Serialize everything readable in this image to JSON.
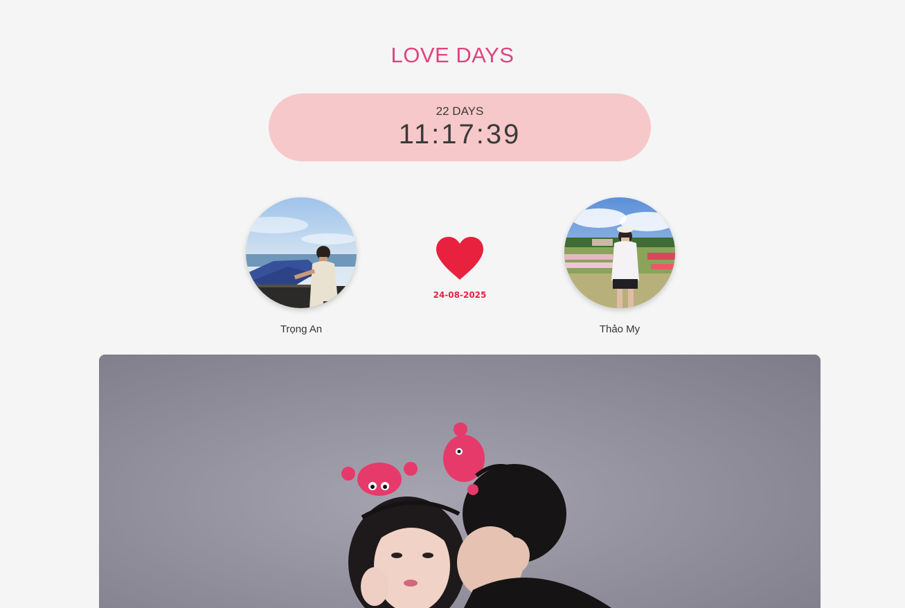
{
  "header": {
    "title": "LOVE DAYS"
  },
  "counter": {
    "days_label": "22 DAYS",
    "time": "11:17:39"
  },
  "partners": {
    "left": {
      "name": "Trọng An"
    },
    "right": {
      "name": "Thảo My"
    }
  },
  "anniversary": {
    "date": "24-08-2025"
  },
  "icons": {
    "heart": "heart-icon"
  },
  "colors": {
    "title": "#e0427f",
    "counter_bg": "#f7c8c9",
    "heart": "#e8213e",
    "date": "#e52245",
    "background": "#f5f5f5"
  }
}
